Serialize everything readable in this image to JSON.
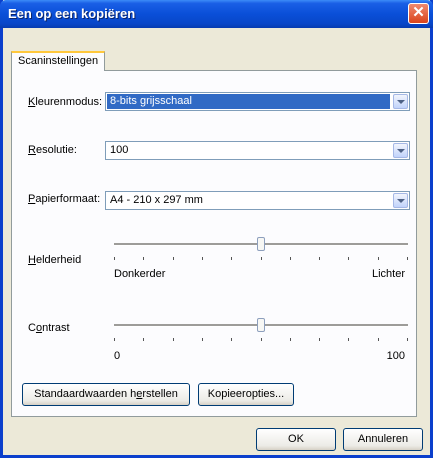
{
  "window": {
    "title": "Een op een kopiëren"
  },
  "tab": {
    "label": "Scaninstellingen"
  },
  "color_mode": {
    "label_first": "K",
    "label_rest": "leurenmodus:",
    "value": "8-bits grijsschaal"
  },
  "resolution": {
    "label_first": "R",
    "label_rest": "esolutie:",
    "value": "100"
  },
  "paper_format": {
    "label_first": "P",
    "label_rest": "apierformaat:",
    "value": "A4 - 210 x 297 mm"
  },
  "brightness": {
    "label_first": "H",
    "label_rest": "elderheid",
    "min_label": "Donkerder",
    "max_label": "Lichter",
    "level": 0.5
  },
  "contrast": {
    "label_pre": "C",
    "label_first": "o",
    "label_rest": "ntrast",
    "min_label": "0",
    "max_label": "100",
    "level": 0.5
  },
  "buttons": {
    "defaults_pre": "Standaardwaarden h",
    "defaults_first": "e",
    "defaults_rest": "rstellen",
    "copy_options": "Kopieeropties...",
    "ok": "OK",
    "cancel": "Annuleren"
  },
  "colors": {
    "titlebar": "#0a4fd8",
    "selection": "#316ac5",
    "dialog_bg": "#ece9d8"
  },
  "icons": {
    "close": "close-icon"
  }
}
